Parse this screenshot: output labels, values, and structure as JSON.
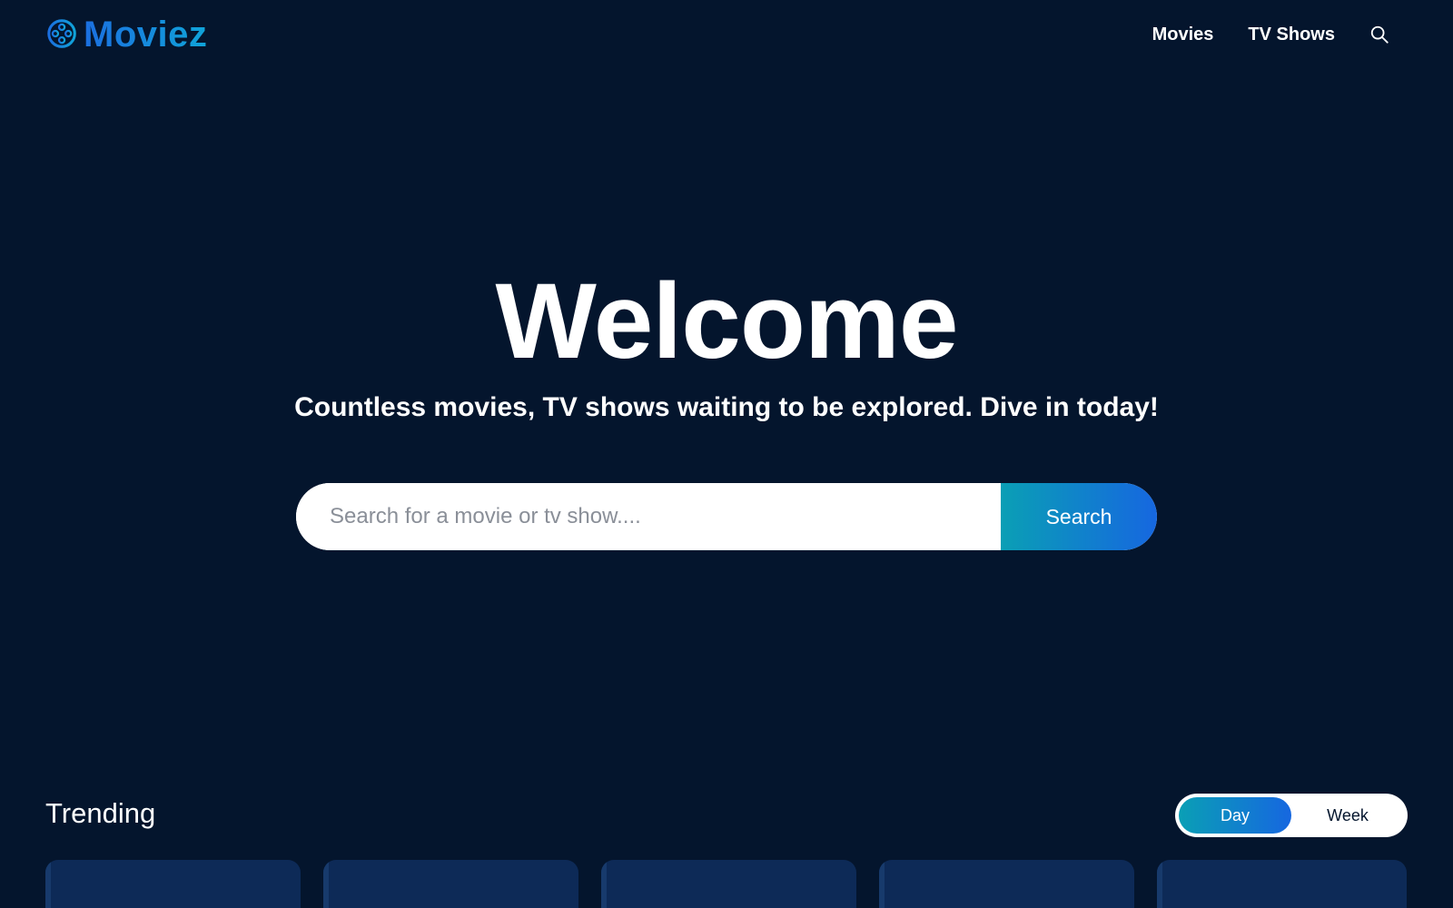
{
  "header": {
    "logo_text": "Moviez",
    "logo_icon": "film-reel-icon",
    "nav": {
      "movies_label": "Movies",
      "tv_shows_label": "TV Shows",
      "search_icon": "search-icon"
    }
  },
  "hero": {
    "title": "Welcome",
    "subtitle": "Countless movies, TV shows waiting to be explored. Dive in today!",
    "search": {
      "placeholder": "Search for a movie or tv show....",
      "button_label": "Search"
    }
  },
  "trending": {
    "title": "Trending",
    "tabs": [
      {
        "label": "Day",
        "active": true
      },
      {
        "label": "Week",
        "active": false
      }
    ],
    "card_count_visible": 5
  },
  "colors": {
    "background": "#04152d",
    "card": "#0d2a57",
    "accent_start": "#0a9fb5",
    "accent_end": "#1667e0",
    "logo_blue": "#1b6fe0"
  }
}
